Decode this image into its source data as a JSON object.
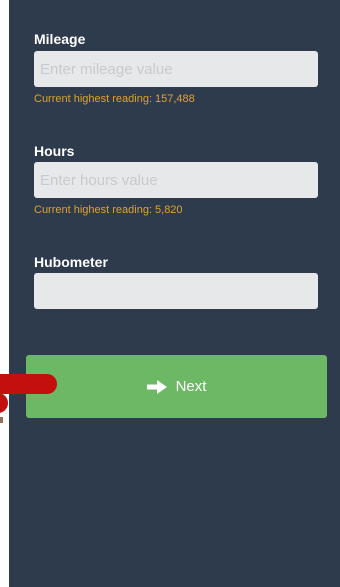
{
  "form": {
    "mileage": {
      "label": "Mileage",
      "placeholder": "Enter mileage value",
      "value": "",
      "hint_prefix": "Current highest reading:",
      "hint_value": "157,488"
    },
    "hours": {
      "label": "Hours",
      "placeholder": "Enter hours value",
      "value": "",
      "hint_prefix": "Current highest reading:",
      "hint_value": "5,820"
    },
    "hubometer": {
      "label": "Hubometer",
      "placeholder": "",
      "value": ""
    }
  },
  "actions": {
    "next_label": "Next",
    "next_icon": "arrow-right-icon"
  },
  "colors": {
    "panel_bg": "#2e3b4c",
    "input_bg": "#e7e8ea",
    "hint_text": "#e0a22a",
    "next_button_bg": "#6cb865",
    "annotation_red": "#c40f0f"
  }
}
